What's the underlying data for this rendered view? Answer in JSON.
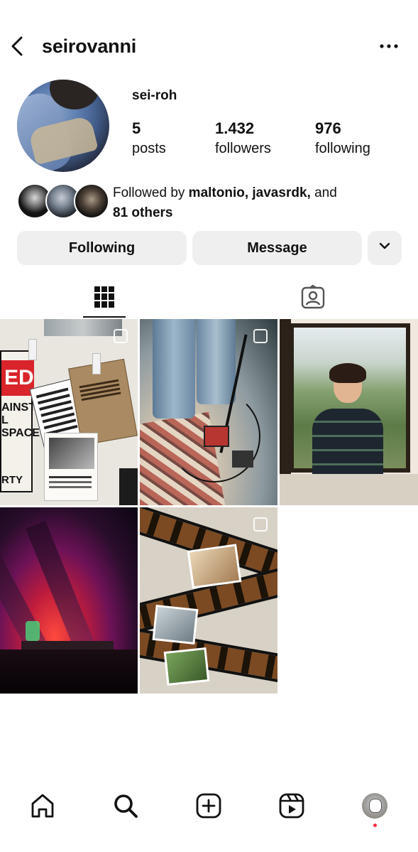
{
  "header": {
    "username": "seirovanni",
    "back_icon": "chevron-left-icon",
    "more_icon": "more-horizontal-icon"
  },
  "profile": {
    "display_name": "sei-roh",
    "stats": {
      "posts": {
        "value": "5",
        "label": "posts"
      },
      "followers": {
        "value": "1.432",
        "label": "followers"
      },
      "following": {
        "value": "976",
        "label": "following"
      }
    },
    "followed_by": {
      "prefix": "Followed by ",
      "names": "maltonio, javasrdk,",
      "connector": " and",
      "others": "81 others"
    }
  },
  "actions": {
    "following_label": "Following",
    "message_label": "Message",
    "dropdown_icon": "chevron-down-icon"
  },
  "tabs": [
    {
      "name": "grid",
      "icon": "grid-icon",
      "active": true
    },
    {
      "name": "tagged",
      "icon": "tagged-person-icon",
      "active": false
    }
  ],
  "posts_overlay_text": {
    "poster_red": "ED",
    "poster_line1": "AINST",
    "poster_line2": "L SPACE",
    "poster_line3": "RTY"
  },
  "bottom_nav": [
    {
      "name": "home",
      "icon": "home-icon"
    },
    {
      "name": "search",
      "icon": "search-icon",
      "active": true
    },
    {
      "name": "create",
      "icon": "plus-square-icon"
    },
    {
      "name": "reels",
      "icon": "reels-icon"
    },
    {
      "name": "profile",
      "icon": "profile-avatar",
      "notification": true
    }
  ],
  "colors": {
    "button_bg": "#efefef",
    "text": "#111111",
    "notification": "#ff3040"
  }
}
